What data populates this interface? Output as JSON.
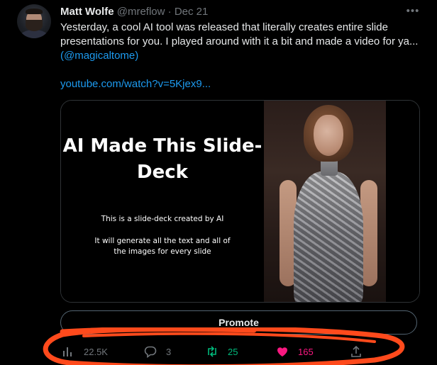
{
  "tweet": {
    "author_name": "Matt Wolfe",
    "handle": "@mreflow",
    "separator": "·",
    "date": "Dec 21",
    "more_icon": "more-horizontal-icon",
    "text": "Yesterday, a cool AI tool was released that literally creates entire slide presentations for you. I played around with it a bit and made a video for ya...",
    "mention": "(@magicaltome)",
    "link": "youtube.com/watch?v=5Kjex9..."
  },
  "media": {
    "slide_title": "AI Made This Slide-Deck",
    "slide_subtitle": "This is a slide-deck created by AI",
    "slide_description": "It will generate all the text and all of the images for every slide"
  },
  "promote": {
    "label": "Promote"
  },
  "actions": {
    "views": {
      "icon": "analytics-icon",
      "count": "22.5K"
    },
    "replies": {
      "icon": "reply-icon",
      "count": "3"
    },
    "retweets": {
      "icon": "retweet-icon",
      "count": "25"
    },
    "likes": {
      "icon": "heart-filled-icon",
      "count": "165"
    },
    "share": {
      "icon": "share-icon"
    }
  },
  "colors": {
    "background": "#000000",
    "text": "#e7e9ea",
    "muted": "#71767b",
    "link": "#1d9bf0",
    "retweet": "#00ba7c",
    "like": "#f91880",
    "annotation": "#ff4a1c"
  }
}
